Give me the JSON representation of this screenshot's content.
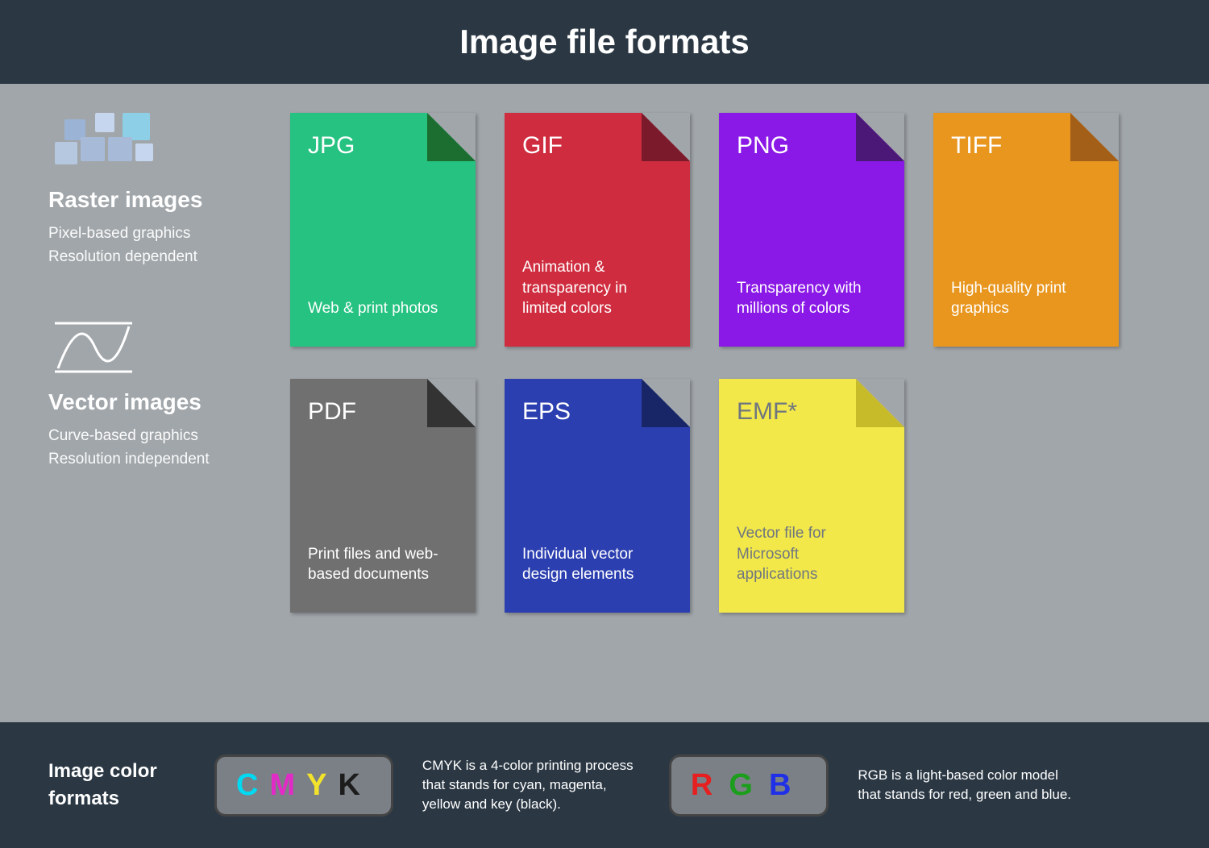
{
  "title": "Image file formats",
  "sections": {
    "raster": {
      "title": "Raster images",
      "line1": "Pixel-based graphics",
      "line2": "Resolution dependent"
    },
    "vector": {
      "title": "Vector images",
      "line1": "Curve-based graphics",
      "line2": "Resolution independent"
    }
  },
  "formats": {
    "raster": [
      {
        "label": "JPG",
        "desc": "Web & print photos",
        "bg": "#26c281",
        "fold": "#1b6e2f"
      },
      {
        "label": "GIF",
        "desc": "Animation & transparency in limited colors",
        "bg": "#cf2d3f",
        "fold": "#7b1a2b"
      },
      {
        "label": "PNG",
        "desc": "Transparency with millions of colors",
        "bg": "#8a18e6",
        "fold": "#4b1877"
      },
      {
        "label": "TIFF",
        "desc": "High-quality print graphics",
        "bg": "#e8961e",
        "fold": "#a35e17"
      }
    ],
    "vector": [
      {
        "label": "PDF",
        "desc": "Print files and web-based documents",
        "bg": "#707070",
        "fold": "#333333",
        "darkText": false
      },
      {
        "label": "EPS",
        "desc": "Individual vector design elements",
        "bg": "#2c3fb0",
        "fold": "#182668",
        "darkText": false
      },
      {
        "label": "EMF*",
        "desc": "Vector file for Microsoft applications",
        "bg": "#f2e84a",
        "fold": "#c7bb2a",
        "darkText": true
      }
    ]
  },
  "footer": {
    "title": "Image color formats",
    "cmyk": {
      "letters": [
        {
          "ch": "C",
          "color": "#00d9f2"
        },
        {
          "ch": "M",
          "color": "#e22bc6"
        },
        {
          "ch": "Y",
          "color": "#f2e22b"
        },
        {
          "ch": "K",
          "color": "#1c1c1c"
        }
      ],
      "desc": "CMYK is a 4-color printing process that stands for cyan, magenta, yellow and key (black)."
    },
    "rgb": {
      "letters": [
        {
          "ch": "R",
          "color": "#e62020"
        },
        {
          "ch": "G",
          "color": "#1b9e1b"
        },
        {
          "ch": "B",
          "color": "#2030e6"
        }
      ],
      "desc": "RGB is a light-based color model that stands for red, green and blue."
    }
  }
}
